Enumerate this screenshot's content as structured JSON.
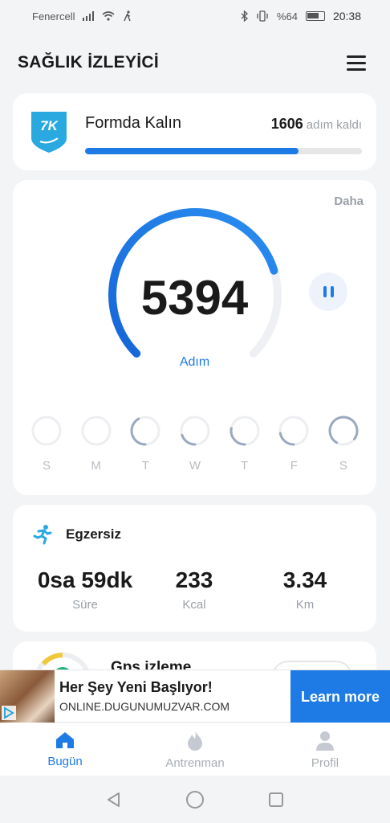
{
  "status_bar": {
    "carrier": "Fenercell",
    "battery": "%64",
    "time": "20:38"
  },
  "app": {
    "title": "SAĞLIK İZLEYİCİ",
    "menu_icon": "hamburger-menu-icon"
  },
  "goal": {
    "badge_text": "7K",
    "title": "Formda Kalın",
    "remaining": "1606",
    "remaining_label": "adım kaldı",
    "progress": 0.77
  },
  "steps": {
    "more_label": "Daha",
    "count": "5394",
    "unit_label": "Adım",
    "ring_progress": 0.77,
    "pause_icon": "pause-icon"
  },
  "week": {
    "days": [
      {
        "label": "S",
        "progress": 0.0
      },
      {
        "label": "M",
        "progress": 0.0
      },
      {
        "label": "T",
        "progress": 0.42
      },
      {
        "label": "W",
        "progress": 0.2
      },
      {
        "label": "T",
        "progress": 0.28
      },
      {
        "label": "F",
        "progress": 0.22
      },
      {
        "label": "S",
        "progress": 0.77
      }
    ]
  },
  "exercise": {
    "title": "Egzersiz",
    "icon": "running-person-icon",
    "stats": [
      {
        "value": "0sa 59dk",
        "label": "Süre"
      },
      {
        "value": "233",
        "label": "Kcal"
      },
      {
        "value": "3.34",
        "label": "Km"
      }
    ]
  },
  "gps_card": {
    "title": "Gps izleme"
  },
  "ad": {
    "headline": "Her Şey Yeni Başlıyor!",
    "url": "ONLINE.DUGUNUMUZVAR.COM",
    "cta": "Learn more"
  },
  "bottom_nav": [
    {
      "label": "Bugün",
      "icon": "home-icon",
      "active": true
    },
    {
      "label": "Antrenman",
      "icon": "flame-icon",
      "active": false
    },
    {
      "label": "Profil",
      "icon": "person-icon",
      "active": false
    }
  ],
  "colors": {
    "accent": "#1e7be6",
    "track": "#e6e6e6",
    "muted": "#9aa0a6"
  }
}
